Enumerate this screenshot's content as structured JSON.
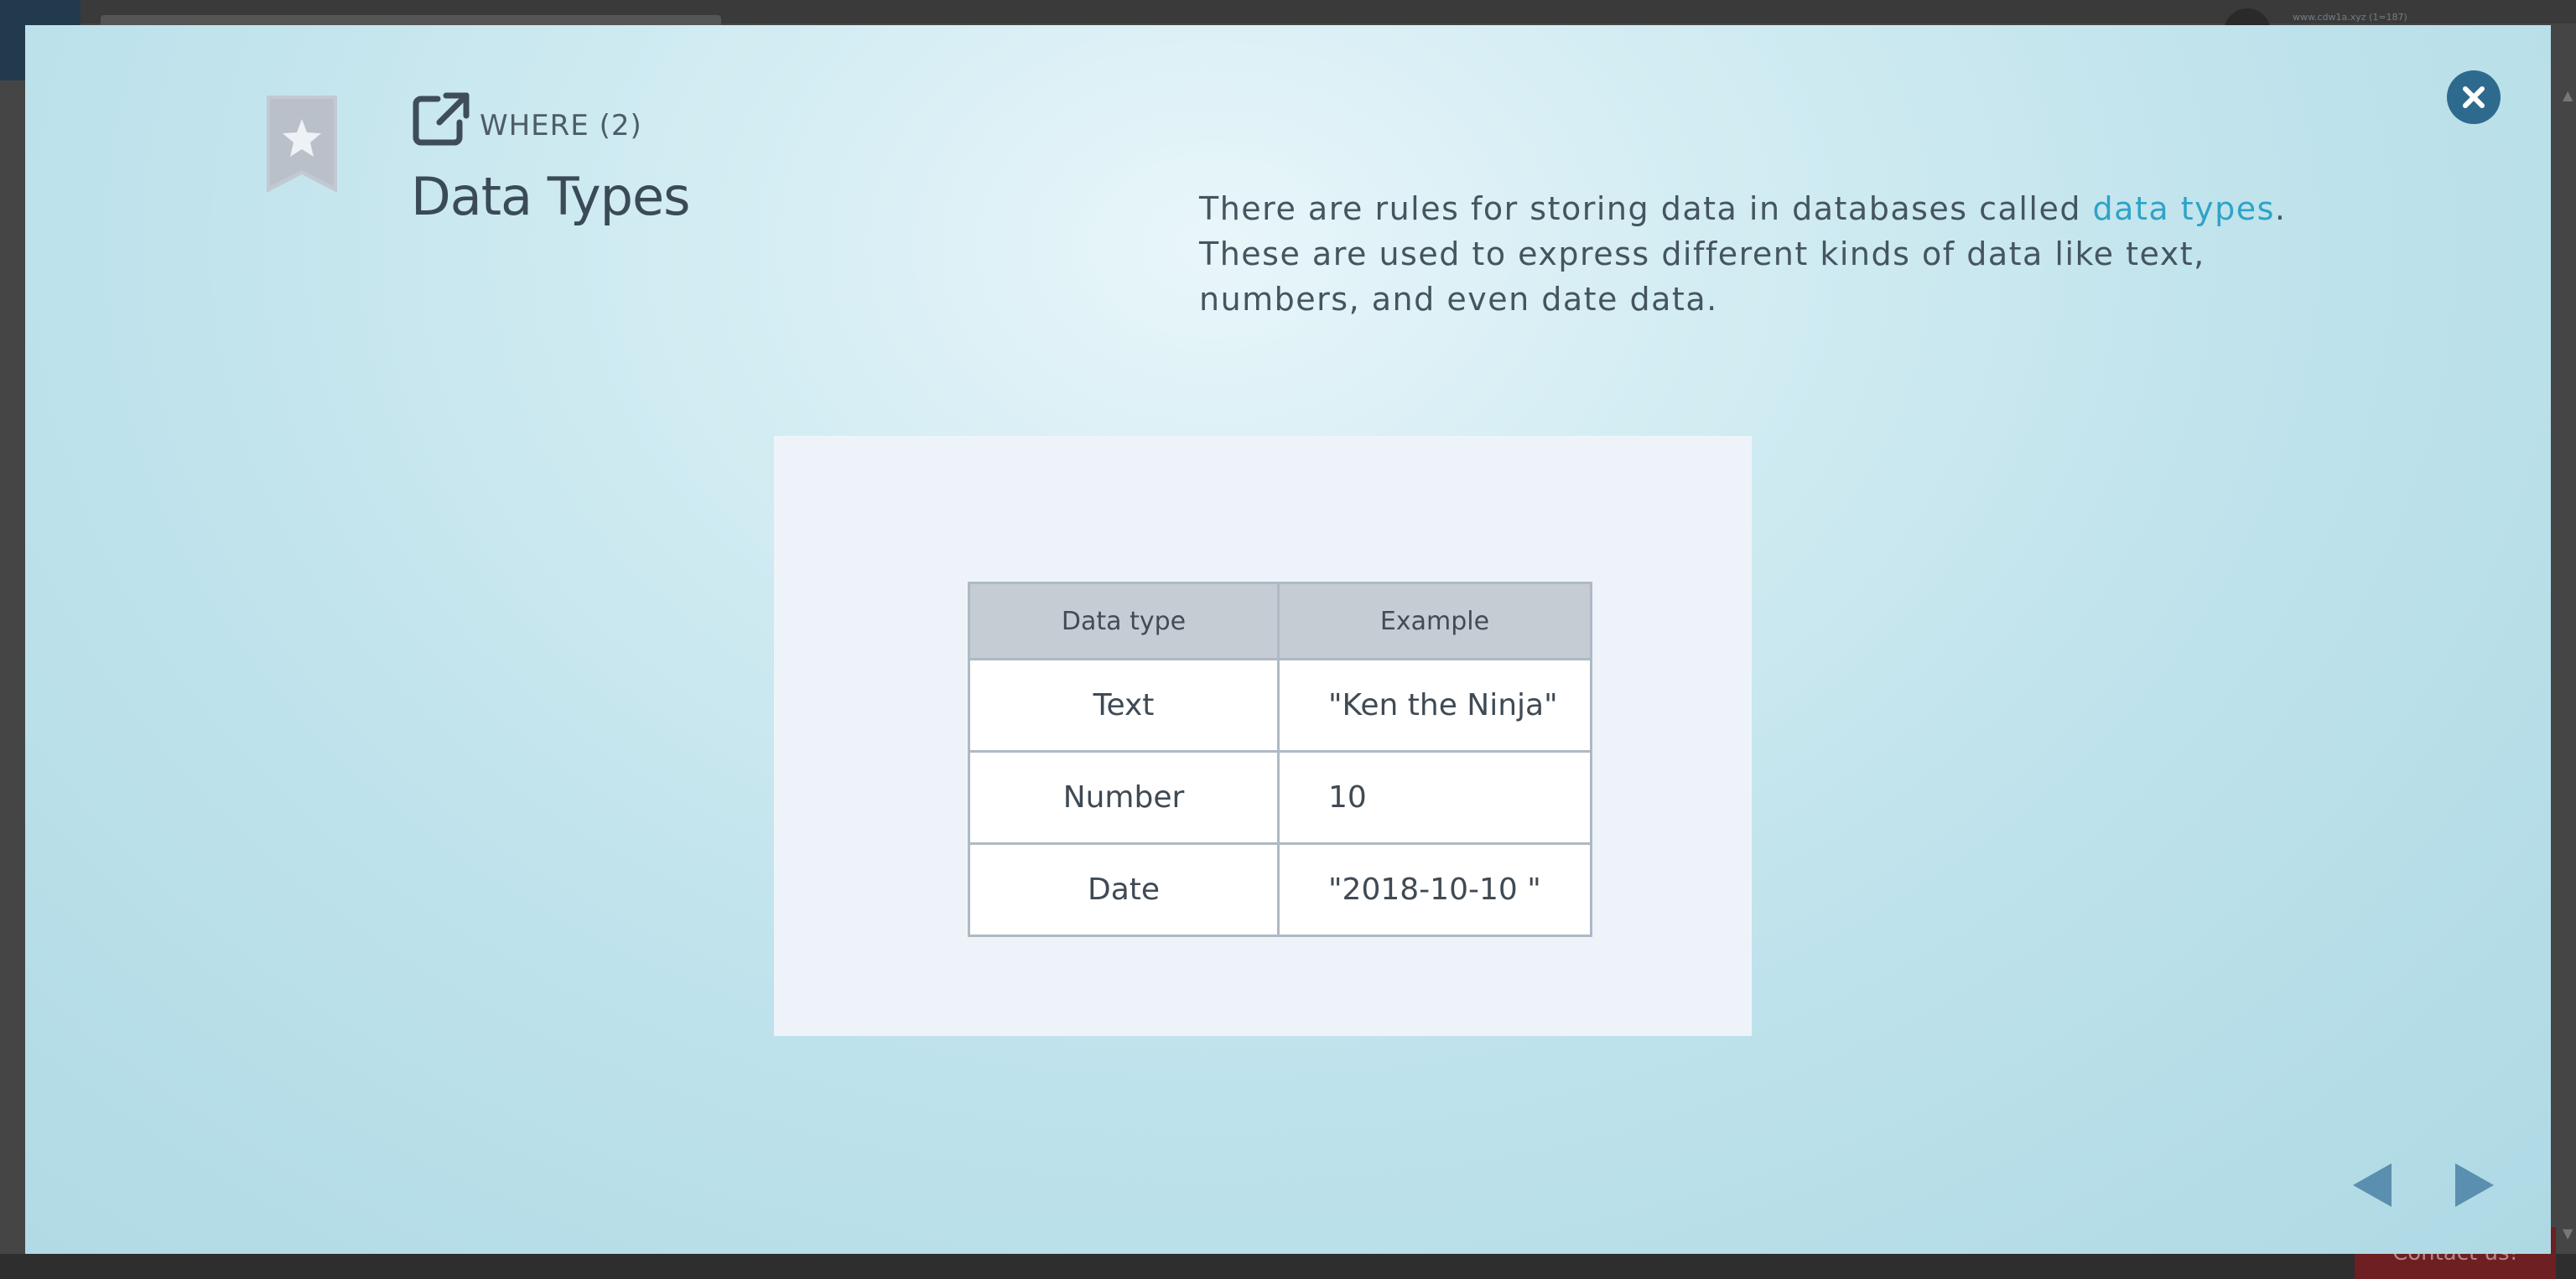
{
  "background": {
    "url_text": "www.cdw1a.xyz (1=187)",
    "contact_label": "Contact us!"
  },
  "slide": {
    "section_label": "WHERE (2)",
    "title": "Data Types",
    "description": {
      "before_link": "There are rules for storing data in databases called ",
      "link_text": "data types",
      "after_link": ". These are used to express different kinds of data like text, numbers, and even date data."
    },
    "table": {
      "headers": [
        "Data type",
        "Example"
      ],
      "rows": [
        [
          "Text",
          "\"Ken the Ninja\""
        ],
        [
          "Number",
          "10"
        ],
        [
          "Date",
          "\"2018-10-10 \""
        ]
      ]
    }
  },
  "icons": {
    "bookmark": "bookmark-star-icon",
    "external": "external-link-icon",
    "close": "close-icon",
    "prev": "arrow-left-icon",
    "next": "arrow-right-icon"
  },
  "colors": {
    "link": "#2fa3c7",
    "close_button": "#2d6a8e",
    "nav_arrows": "#5a8fb0",
    "bookmark": "#c3c9d2"
  }
}
